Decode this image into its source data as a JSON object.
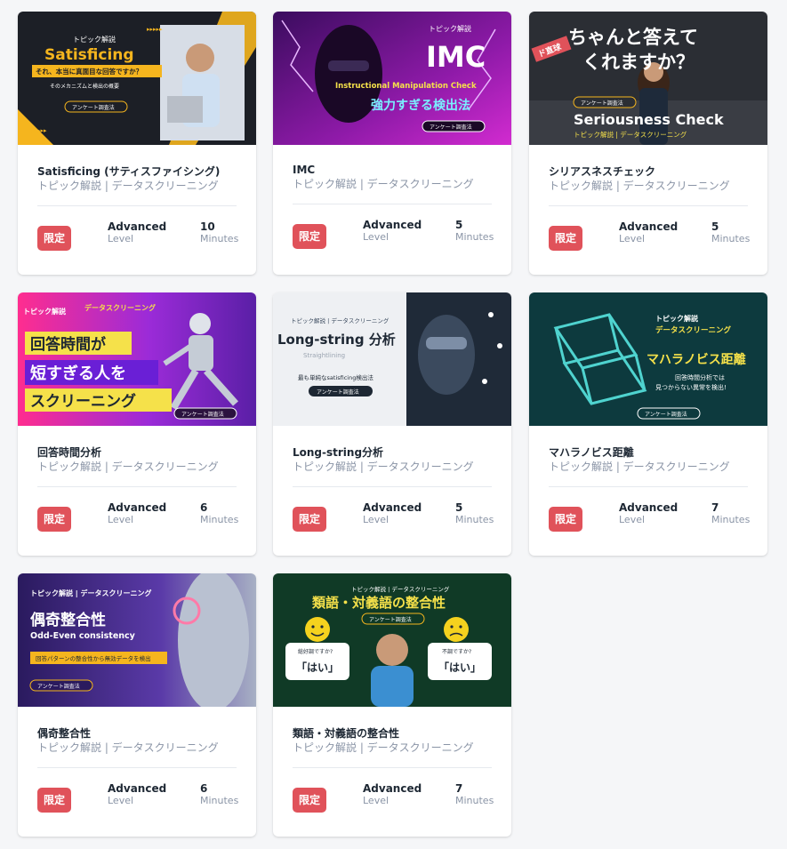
{
  "cards": [
    {
      "thumb": {
        "head": "トピック解説",
        "title": "Satisficing",
        "line1": "それ、本当に真面目な回答ですか？",
        "line2": "そのメカニズムと検出の概要",
        "tag": "アンケート調査法"
      },
      "title": "Satisficing (サティスファイシング)",
      "subtitle": "トピック解説 | データスクリーニング",
      "badge": "限定",
      "level": "Advanced",
      "level_label": "Level",
      "duration": "10",
      "duration_label": "Minutes"
    },
    {
      "thumb": {
        "head": "トピック解説",
        "title": "IMC",
        "line1": "Instructional Manipulation Check",
        "line2": "強力すぎる検出法",
        "tag": "アンケート調査法"
      },
      "title": "IMC",
      "subtitle": "トピック解説 | データスクリーニング",
      "badge": "限定",
      "level": "Advanced",
      "level_label": "Level",
      "duration": "5",
      "duration_label": "Minutes"
    },
    {
      "thumb": {
        "stamp": "ド直球",
        "line1": "ちゃんと答えて",
        "line2": "くれますか？",
        "tag": "アンケート調査法",
        "title": "Seriousness Check",
        "sub": "トピック解説 | データスクリーニング"
      },
      "title": "シリアスネスチェック",
      "subtitle": "トピック解説 | データスクリーニング",
      "badge": "限定",
      "level": "Advanced",
      "level_label": "Level",
      "duration": "5",
      "duration_label": "Minutes"
    },
    {
      "thumb": {
        "head": "トピック解説",
        "head2": "データスクリーニング",
        "line1": "回答時間が",
        "line2": "短すぎる人を",
        "line3": "スクリーニング",
        "tag": "アンケート調査法"
      },
      "title": "回答時間分析",
      "subtitle": "トピック解説 | データスクリーニング",
      "badge": "限定",
      "level": "Advanced",
      "level_label": "Level",
      "duration": "6",
      "duration_label": "Minutes"
    },
    {
      "thumb": {
        "head": "トピック解説 | データスクリーニング",
        "title": "Long-string 分析",
        "sub": "Straightlining",
        "line1": "最も単純なsatisficing検出法",
        "tag": "アンケート調査法"
      },
      "title": "Long-string分析",
      "subtitle": "トピック解説 | データスクリーニング",
      "badge": "限定",
      "level": "Advanced",
      "level_label": "Level",
      "duration": "5",
      "duration_label": "Minutes"
    },
    {
      "thumb": {
        "head": "トピック解説",
        "head2": "データスクリーニング",
        "title": "マハラノビス距離",
        "line1": "回答時間分析では",
        "line2": "見つからない異常を検出!",
        "tag": "アンケート調査法"
      },
      "title": "マハラノビス距離",
      "subtitle": "トピック解説 | データスクリーニング",
      "badge": "限定",
      "level": "Advanced",
      "level_label": "Level",
      "duration": "7",
      "duration_label": "Minutes"
    },
    {
      "thumb": {
        "head": "トピック解説 | データスクリーニング",
        "title": "偶奇整合性",
        "sub": "Odd-Even consistency",
        "line1": "回答パターンの整合性から無効データを検出",
        "tag": "アンケート調査法"
      },
      "title": "偶奇整合性",
      "subtitle": "トピック解説 | データスクリーニング",
      "badge": "限定",
      "level": "Advanced",
      "level_label": "Level",
      "duration": "6",
      "duration_label": "Minutes"
    },
    {
      "thumb": {
        "head": "トピック解説 | データスクリーニング",
        "title": "類語・対義語の整合性",
        "tag": "アンケート調査法",
        "q1": "総好調ですか?",
        "a1": "「はい」",
        "q2": "不調ですか?",
        "a2": "「はい」"
      },
      "title": "類語・対義語の整合性",
      "subtitle": "トピック解説 | データスクリーニング",
      "badge": "限定",
      "level": "Advanced",
      "level_label": "Level",
      "duration": "7",
      "duration_label": "Minutes"
    }
  ]
}
